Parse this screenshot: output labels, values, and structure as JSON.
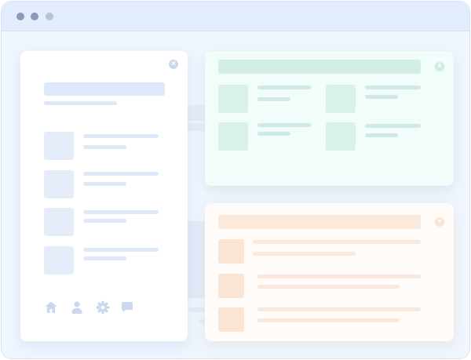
{
  "colors": {
    "window_border": "#d8e4f6",
    "window_bg": "#f0f6fe",
    "titlebar_bg": "#e2ecfa",
    "dot_dark": "#8a9bb8",
    "dot_light": "#b4c3d9",
    "blue_bar": "#dde8f8",
    "blue_thumb": "#e4edf9",
    "blue_icon": "#c9d8ee",
    "green_card": "#f2fcfb",
    "green_header": "#d2efe6",
    "green_bar": "#cfeae4",
    "green_thumb": "#daf0ea",
    "peach_card": "#fffbf8",
    "peach_header": "#fbe9dc",
    "peach_bar": "#fae8dc",
    "peach_thumb": "#fae5d4"
  },
  "icons": {
    "left_close": "close-icon",
    "green_close": "close-icon",
    "peach_close": "close-icon",
    "nav": [
      "home-icon",
      "user-icon",
      "gear-icon",
      "chat-icon"
    ]
  },
  "window": {
    "window_controls": [
      "close-dot",
      "minimize-dot",
      "maximize-dot"
    ]
  }
}
